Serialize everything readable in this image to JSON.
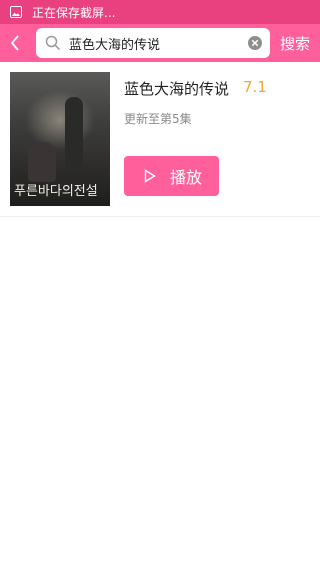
{
  "status_bar": {
    "notification_text": "正在保存截屏...",
    "icon": "screenshot-icon"
  },
  "toolbar": {
    "back_icon": "chevron-left-icon",
    "search": {
      "icon": "search-icon",
      "value": "蓝色大海的传说",
      "clear_icon": "clear-circle-icon"
    },
    "search_button": "搜索"
  },
  "result": {
    "title": "蓝色大海的传说",
    "rating": "7.1",
    "update_status": "更新至第5集",
    "play_label": "播放",
    "poster_text": "푸른바다의전설"
  },
  "colors": {
    "accent": "#ff5f9a",
    "status_bar": "#e9417f",
    "rating": "#f6a531"
  }
}
